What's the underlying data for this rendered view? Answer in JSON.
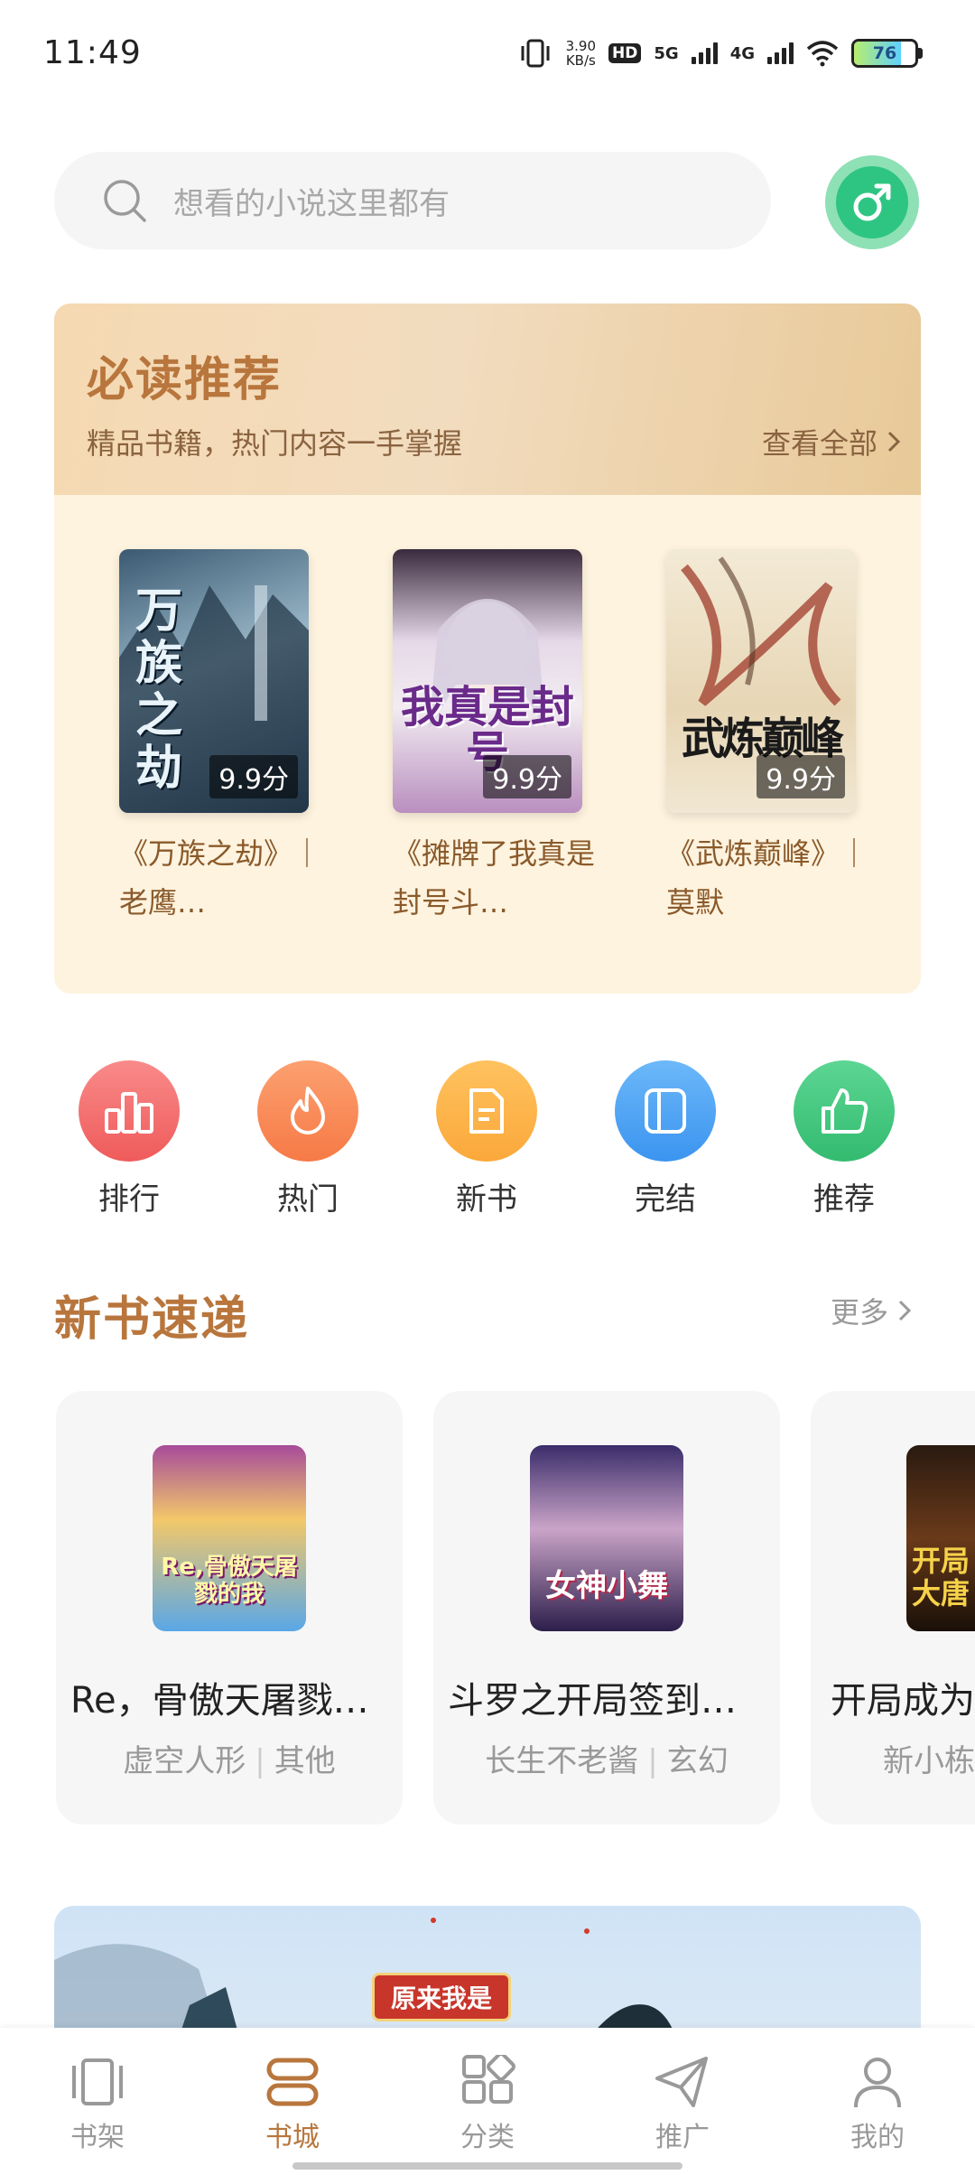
{
  "status_bar": {
    "time": "11:49",
    "net_speed_value": "3.90",
    "net_speed_unit": "KB/s",
    "hd_label": "HD",
    "sim1": "5G",
    "sim2": "4G",
    "battery": "76",
    "battery_level": 0.76
  },
  "search": {
    "placeholder": "想看的小说这里都有",
    "gender_symbol": "♂"
  },
  "recommend": {
    "title": "必读推荐",
    "subtitle": "精品书籍，热门内容一手掌握",
    "view_all": "查看全部",
    "books": [
      {
        "cover_text": "万族之劫",
        "score": "9.9分",
        "title": "《万族之劫》｜老鹰…"
      },
      {
        "cover_text": "我真是封号",
        "score": "9.9分",
        "title": "《摊牌了我真是封号斗…"
      },
      {
        "cover_text": "武炼巅峰",
        "score": "9.9分",
        "title": "《武炼巅峰》｜莫默"
      }
    ]
  },
  "categories": [
    {
      "label": "排行",
      "icon": "ranking-icon",
      "color": "#f36f6f"
    },
    {
      "label": "热门",
      "icon": "fire-icon",
      "color": "#f98d5b"
    },
    {
      "label": "新书",
      "icon": "new-book-icon",
      "color": "#fdb24b"
    },
    {
      "label": "完结",
      "icon": "finished-book-icon",
      "color": "#4ea6f5"
    },
    {
      "label": "推荐",
      "icon": "thumbs-up-icon",
      "color": "#3cc27a"
    }
  ],
  "new_books": {
    "title": "新书速递",
    "more": "更多",
    "items": [
      {
        "cover_text": "Re,骨傲天屠戮的我",
        "name": "Re，骨傲天屠戮…",
        "author": "虚空人形",
        "genre": "其他"
      },
      {
        "cover_text": "女神小舞",
        "name": "斗罗之开局签到…",
        "author": "长生不老酱",
        "genre": "玄幻"
      },
      {
        "cover_text": "开局大唐",
        "name": "开局成为",
        "author": "新小栋",
        "genre": ""
      }
    ]
  },
  "banner": {
    "text": "原来我是"
  },
  "bottom_nav": [
    {
      "label": "书架",
      "icon": "bookshelf-icon",
      "active": false
    },
    {
      "label": "书城",
      "icon": "bookstore-icon",
      "active": true
    },
    {
      "label": "分类",
      "icon": "category-icon",
      "active": false
    },
    {
      "label": "推广",
      "icon": "share-plane-icon",
      "active": false
    },
    {
      "label": "我的",
      "icon": "profile-icon",
      "active": false
    }
  ]
}
